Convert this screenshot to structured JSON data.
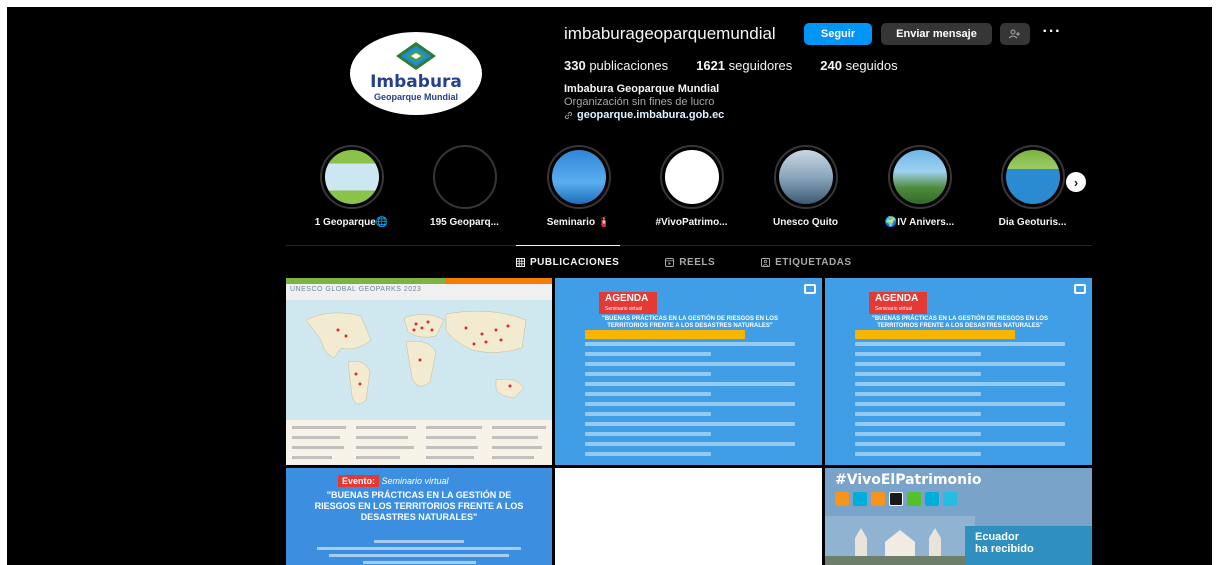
{
  "profile": {
    "username": "imbaburageoparquemundial",
    "follow_label": "Seguir",
    "message_label": "Enviar mensaje",
    "more_label": "···",
    "avatar_text_line1": "Imbabura",
    "avatar_text_line2": "Geoparque Mundial",
    "stats": {
      "posts_count": "330",
      "posts_label": "publicaciones",
      "followers_count": "1621",
      "followers_label": "seguidores",
      "following_count": "240",
      "following_label": "seguidos"
    },
    "bio": {
      "name": "Imbabura Geoparque Mundial",
      "category": "Organización sin fines de lucro",
      "link": "geoparque.imbabura.gob.ec"
    }
  },
  "highlights": [
    {
      "label": "1 Geoparque🌐"
    },
    {
      "label": "195 Geoparq..."
    },
    {
      "label": "Seminario 🧯"
    },
    {
      "label": "#VivoPatrimo..."
    },
    {
      "label": "Unesco Quito"
    },
    {
      "label": "🌍IV Anivers..."
    },
    {
      "label": "Dia Geoturis..."
    }
  ],
  "tabs": [
    {
      "label": "PUBLICACIONES",
      "icon": "grid-icon",
      "active": true
    },
    {
      "label": "REELS",
      "icon": "reels-icon",
      "active": false
    },
    {
      "label": "ETIQUETADAS",
      "icon": "tagged-icon",
      "active": false
    }
  ],
  "posts": {
    "post1_header": "UNESCO GLOBAL GEOPARKS 2023",
    "post2_badge": "AGENDA",
    "post2_badge_sub": "Seminario virtual",
    "post2_title": "\"BUENAS PRÁCTICAS EN LA GESTIÓN DE RIESGOS EN LOS TERRITORIOS FRENTE A LOS DESASTRES NATURALES\"",
    "post3_badge": "AGENDA",
    "post3_badge_sub": "Seminario virtual",
    "post3_title": "\"BUENAS PRÁCTICAS EN LA GESTIÓN DE RIESGOS EN LOS TERRITORIOS FRENTE A LOS DESASTRES NATURALES\"",
    "post4_event": "Evento:",
    "post4_event_sub": "Seminario virtual",
    "post4_title": "\"BUENAS PRÁCTICAS EN LA GESTIÓN DE RIESGOS EN LOS TERRITORIOS FRENTE A LOS DESASTRES NATURALES\"",
    "post6_title": "#VivoElPatrimonio",
    "post6_line1": "Ecuador",
    "post6_line2": "ha recibido"
  },
  "colors": {
    "background": "#000000",
    "primary_button": "#0095f6",
    "secondary_button": "#363636",
    "agenda_red": "#e53935",
    "agenda_blue": "#3f9ee6"
  }
}
